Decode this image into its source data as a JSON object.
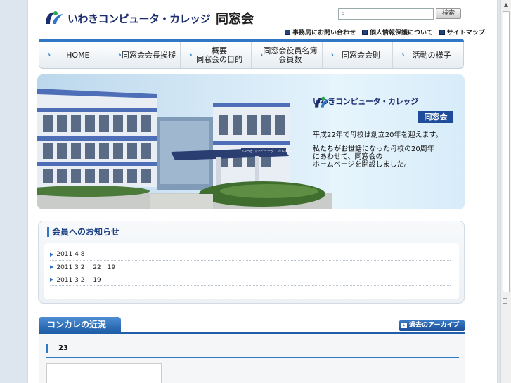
{
  "header": {
    "logo_text": "いわきコンピュータ・カレッジ",
    "logo_doso": "同窓会",
    "search_placeholder": "",
    "search_button": "検索",
    "utility_links": [
      "事務局にお問い合わせ",
      "個人情報保護について",
      "サイトマップ"
    ]
  },
  "nav": {
    "items": [
      {
        "label": "HOME"
      },
      {
        "label": "同窓会会長挨拶"
      },
      {
        "label": "概要\n同窓会の目的"
      },
      {
        "label": "同窓会役員名簿\n会員数"
      },
      {
        "label": "同窓会会則"
      },
      {
        "label": "活動の様子"
      }
    ]
  },
  "hero": {
    "logo_text": "いわきコンピュータ・カレッジ",
    "badge": "同窓会",
    "text1": "平成22年で母校は創立20年を迎えます。",
    "text2": "私たちがお世話になった母校の20周年\nにあわせて、同窓会の\nホームページを開設しました。",
    "building_sign": "いわきコンピュータ・カレッジ"
  },
  "notice": {
    "title": "会員へのお知らせ",
    "items": [
      "2011 4 8",
      "2011 3 2　 22　19",
      "2011 3 2　 19"
    ]
  },
  "news": {
    "tab_title": "コンカレの近況",
    "archive_button": "過去のアーカイブ",
    "item": "23"
  },
  "colors": {
    "accent_blue": "#2f78c6",
    "navy": "#1c2d6e",
    "badge_blue": "#1f4c9a"
  },
  "icons": [
    "search-icon",
    "chevron-right-icon",
    "square-bullet-icon",
    "triangle-bullet-icon"
  ]
}
